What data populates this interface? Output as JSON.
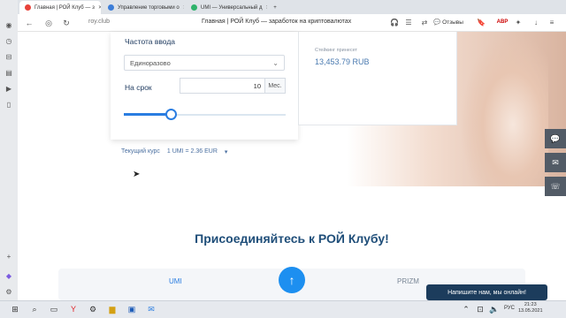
{
  "browser": {
    "tabs": [
      {
        "title": "Главная | РОЙ Клуб — з",
        "active": true
      },
      {
        "title": "Управление торговыми о",
        "active": false
      },
      {
        "title": "UMI — Универсальный д",
        "active": false
      }
    ],
    "address": "roy.club",
    "page_title": "Главная | РОЙ Клуб — заработок на криптовалютах",
    "reviews_label": "Отзывы"
  },
  "calculator": {
    "freq_label": "Частота ввода",
    "freq_value": "Единоразово",
    "term_label": "На срок",
    "term_value": "10",
    "term_unit": "Мес.",
    "slider_fraction": 0.29,
    "stake_label": "Стейкинг принесет",
    "stake_value": "13,453.79 RUB",
    "rate_label": "Текущий курс",
    "rate_value": "1 UMI = 2.36 EUR"
  },
  "join": {
    "heading": "Присоединяйтесь к РОЙ Клубу!",
    "tab_umi": "UMI",
    "tab_prizm": "PRIZM"
  },
  "chat": {
    "label": "Напишите нам, мы онлайн!"
  },
  "taskbar": {
    "lang": "РУС",
    "time": "21:23",
    "date": "13.05.2021"
  },
  "colors": {
    "accent": "#2a7de1",
    "heading": "#1f4e79",
    "chat_bg": "#1c3c5c"
  }
}
